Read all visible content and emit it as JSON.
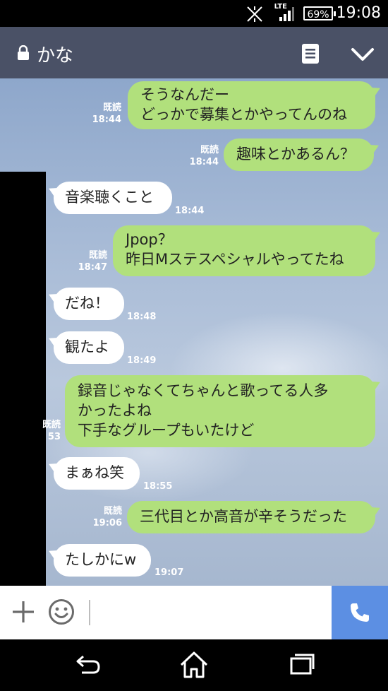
{
  "status": {
    "network": "LTE",
    "battery": "69%",
    "time": "19:08"
  },
  "header": {
    "contact_name": "かな"
  },
  "messages": [
    {
      "side": "sent",
      "lines": [
        "そうなんだー",
        "どっかで募集とかやってんのね"
      ],
      "read": "既読",
      "time": "18:44"
    },
    {
      "side": "sent",
      "lines": [
        "趣味とかあるん？"
      ],
      "read": "既読",
      "time": "18:44"
    },
    {
      "side": "recv",
      "lines": [
        "音楽聴くこと"
      ],
      "time": "18:44"
    },
    {
      "side": "sent",
      "lines": [
        "Jpop？",
        "昨日Mステスペシャルやってたね"
      ],
      "read": "既読",
      "time": "18:47"
    },
    {
      "side": "recv",
      "lines": [
        "だね！"
      ],
      "time": "18:48"
    },
    {
      "side": "recv",
      "lines": [
        "観たよ"
      ],
      "time": "18:49"
    },
    {
      "side": "sent",
      "lines": [
        "録音じゃなくてちゃんと歌ってる人多",
        "かったよね",
        "下手なグループもいたけど"
      ],
      "read": "既読",
      "time": "53"
    },
    {
      "side": "recv",
      "lines": [
        "まぁね笑"
      ],
      "time": "18:55"
    },
    {
      "side": "sent",
      "lines": [
        "三代目とか高音が辛そうだった"
      ],
      "read": "既読",
      "time": "19:06"
    },
    {
      "side": "recv",
      "lines": [
        "たしかにw"
      ],
      "time": "19:07"
    }
  ],
  "icons": {
    "lock": "lock-icon",
    "notes": "notes-icon",
    "chevron": "chevron-down-icon",
    "plus": "plus-icon",
    "emoji": "emoji-icon",
    "call": "phone-icon",
    "back": "back-icon",
    "home": "home-icon",
    "recents": "recents-icon"
  },
  "colors": {
    "header_bg": "#4a5166",
    "sent_bubble": "#b1e07c",
    "recv_bubble": "#ffffff",
    "call_button": "#5c8fe3"
  }
}
